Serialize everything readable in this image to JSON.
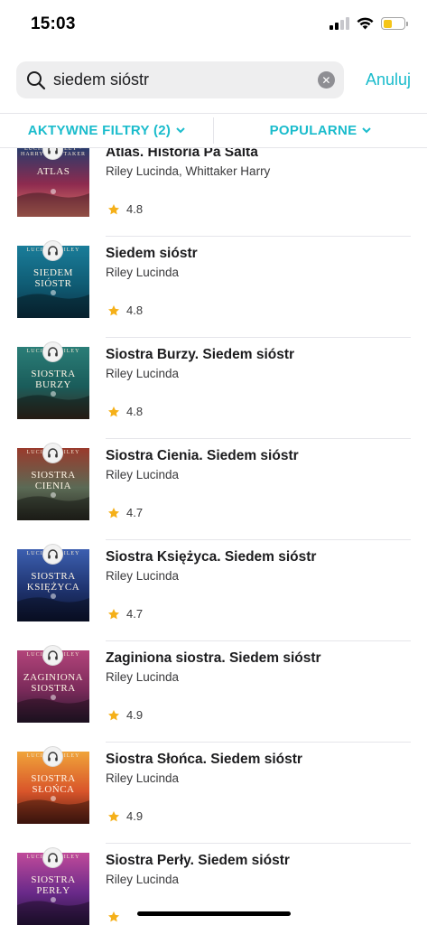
{
  "status": {
    "time": "15:03",
    "battery_level": 0.45
  },
  "search": {
    "query": "siedem sióstr",
    "cancel_label": "Anuluj"
  },
  "filters": {
    "active_label": "AKTYWNE FILTRY (2)",
    "sort_label": "POPULARNE"
  },
  "colors": {
    "accent": "#1bbccc",
    "star": "#f5b019"
  },
  "books": [
    {
      "title": "Atlas. Historia Pa Salta",
      "author": "Riley Lucinda, Whittaker Harry",
      "rating": "4.8",
      "cover_text": "ATLAS",
      "cover_author": "LUCINDA RILEY · HARRY WHITTAKER",
      "cover_colors": [
        "#1f3d6e",
        "#8e2b4f",
        "#e07a6b"
      ]
    },
    {
      "title": "Siedem sióstr",
      "author": "Riley Lucinda",
      "rating": "4.8",
      "cover_text": "SIEDEM SIÓSTR",
      "cover_author": "LUCINDA RILEY",
      "cover_colors": [
        "#1a7d9a",
        "#0f5b73",
        "#0b3347"
      ]
    },
    {
      "title": "Siostra Burzy. Siedem sióstr",
      "author": "Riley Lucinda",
      "rating": "4.8",
      "cover_text": "SIOSTRA BURZY",
      "cover_author": "LUCINDA RILEY",
      "cover_colors": [
        "#2b7e78",
        "#1a5c5a",
        "#3a2b1f"
      ]
    },
    {
      "title": "Siostra Cienia. Siedem sióstr",
      "author": "Riley Lucinda",
      "rating": "4.7",
      "cover_text": "SIOSTRA CIENIA",
      "cover_author": "LUCINDA RILEY",
      "cover_colors": [
        "#9a3a2c",
        "#5b6a55",
        "#2a2a22"
      ]
    },
    {
      "title": "Siostra Księżyca. Siedem sióstr",
      "author": "Riley Lucinda",
      "rating": "4.7",
      "cover_text": "SIOSTRA KSIĘŻYCA",
      "cover_author": "LUCINDA RILEY",
      "cover_colors": [
        "#3c5fb0",
        "#1f3470",
        "#0d1533"
      ]
    },
    {
      "title": "Zaginiona siostra. Siedem sióstr",
      "author": "Riley Lucinda",
      "rating": "4.9",
      "cover_text": "ZAGINIONA SIOSTRA",
      "cover_author": "LUCINDA RILEY",
      "cover_colors": [
        "#b2447a",
        "#7a2a5a",
        "#2a1a30"
      ]
    },
    {
      "title": "Siostra Słońca. Siedem sióstr",
      "author": "Riley Lucinda",
      "rating": "4.9",
      "cover_text": "SIOSTRA SŁOŃCA",
      "cover_author": "LUCINDA RILEY",
      "cover_colors": [
        "#f0a43a",
        "#d9552a",
        "#5a1e14"
      ]
    },
    {
      "title": "Siostra Perły. Siedem sióstr",
      "author": "Riley Lucinda",
      "rating": "",
      "cover_text": "SIOSTRA PERŁY",
      "cover_author": "LUCINDA RILEY",
      "cover_colors": [
        "#c04a9a",
        "#6a2a8a",
        "#2a1540"
      ]
    }
  ]
}
